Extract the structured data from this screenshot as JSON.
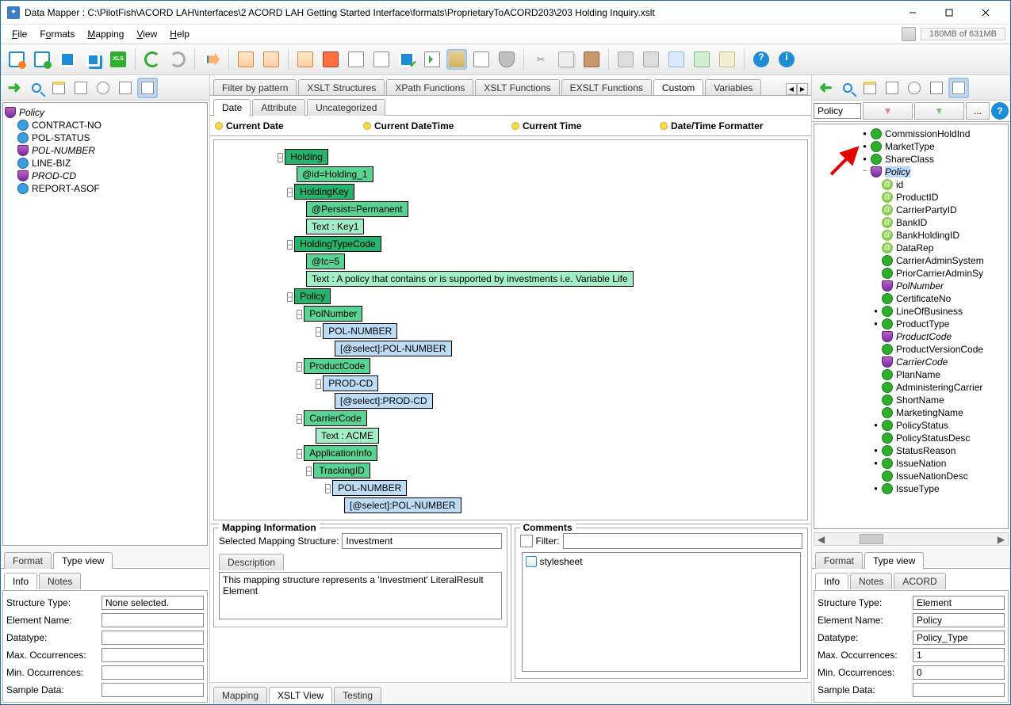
{
  "window": {
    "title": "Data Mapper : C:\\PilotFish\\ACORD LAH\\interfaces\\2 ACORD LAH Getting Started Interface\\formats\\ProprietaryToACORD203\\203 Holding Inquiry.xslt",
    "memory": "180MB of 631MB"
  },
  "menu": {
    "file": "File",
    "formats": "Formats",
    "mapping": "Mapping",
    "view": "View",
    "help": "Help"
  },
  "left_tree": {
    "root": "Policy",
    "items": [
      "CONTRACT-NO",
      "POL-STATUS",
      "POL-NUMBER",
      "LINE-BIZ",
      "PROD-CD",
      "REPORT-ASOF"
    ]
  },
  "left_ftabs": {
    "format": "Format",
    "typeview": "Type view"
  },
  "left_info_tabs": {
    "info": "Info",
    "notes": "Notes"
  },
  "left_info": {
    "structureType_l": "Structure Type:",
    "structureType": "None selected.",
    "elementName_l": "Element Name:",
    "elementName": "",
    "datatype_l": "Datatype:",
    "datatype": "",
    "maxocc_l": "Max. Occurrences:",
    "maxocc": "",
    "minocc_l": "Min. Occurrences:",
    "minocc": "",
    "sample_l": "Sample Data:",
    "sample": ""
  },
  "mid_tabs": {
    "filter": "Filter by pattern",
    "xsltstruct": "XSLT Structures",
    "xpath": "XPath Functions",
    "xsltfn": "XSLT Functions",
    "exslt": "EXSLT Functions",
    "custom": "Custom",
    "variables": "Variables"
  },
  "mid_subtabs": {
    "date": "Date",
    "attribute": "Attribute",
    "uncat": "Uncategorized"
  },
  "mid_pills": {
    "a": "Current Date",
    "b": "Current DateTime",
    "c": "Current Time",
    "d": "Date/Time Formatter"
  },
  "xslt_tree": {
    "holding": "Holding",
    "holding_id": "@id=Holding_1",
    "holdingkey": "HoldingKey",
    "persist": "@Persist=Permanent",
    "key1": "Text : Key1",
    "htc": "HoldingTypeCode",
    "tc5": "@tc=5",
    "tctext": "Text : A policy that contains or is supported by investments i.e. Variable Life",
    "policy": "Policy",
    "polnumber": "PolNumber",
    "polnumber_src": "POL-NUMBER",
    "polnumber_sel": "[@select]:POL-NUMBER",
    "productcode": "ProductCode",
    "prodcd_src": "PROD-CD",
    "prodcd_sel": "[@select]:PROD-CD",
    "carriercode": "CarrierCode",
    "acme": "Text : ACME",
    "appinfo": "ApplicationInfo",
    "trackingid": "TrackingID",
    "trackingid_src": "POL-NUMBER",
    "trackingid_sel": "[@select]:POL-NUMBER"
  },
  "mapinfo": {
    "legend": "Mapping Information",
    "selmap_l": "Selected Mapping Structure:",
    "selmap": "Investment",
    "desc_l": "Description",
    "desc": "This mapping structure represents a 'Investment' LiteralResult Element"
  },
  "comments": {
    "legend": "Comments",
    "filter_l": "Filter:",
    "filter_v": "",
    "body": "stylesheet"
  },
  "mid_bottom_tabs": {
    "mapping": "Mapping",
    "xsltview": "XSLT View",
    "testing": "Testing"
  },
  "right_search": {
    "value": "Policy",
    "more": "..."
  },
  "right_tree": {
    "items": [
      {
        "l": "CommissionHoldInd",
        "i": "g",
        "d": 4,
        "e": "•"
      },
      {
        "l": "MarketType",
        "i": "g",
        "d": 4,
        "e": "•"
      },
      {
        "l": "ShareClass",
        "i": "g",
        "d": 4,
        "e": "•"
      },
      {
        "l": "Policy",
        "i": "shield",
        "d": 4,
        "e": "−",
        "sel": true,
        "it": true
      },
      {
        "l": "id",
        "i": "at",
        "d": 5,
        "e": ""
      },
      {
        "l": "ProductID",
        "i": "at",
        "d": 5,
        "e": ""
      },
      {
        "l": "CarrierPartyID",
        "i": "at",
        "d": 5,
        "e": ""
      },
      {
        "l": "BankID",
        "i": "at",
        "d": 5,
        "e": ""
      },
      {
        "l": "BankHoldingID",
        "i": "at",
        "d": 5,
        "e": ""
      },
      {
        "l": "DataRep",
        "i": "at",
        "d": 5,
        "e": ""
      },
      {
        "l": "CarrierAdminSystem",
        "i": "g",
        "d": 5,
        "e": ""
      },
      {
        "l": "PriorCarrierAdminSy",
        "i": "g",
        "d": 5,
        "e": ""
      },
      {
        "l": "PolNumber",
        "i": "shield",
        "d": 5,
        "e": "",
        "it": true
      },
      {
        "l": "CertificateNo",
        "i": "g",
        "d": 5,
        "e": ""
      },
      {
        "l": "LineOfBusiness",
        "i": "g",
        "d": 5,
        "e": "•"
      },
      {
        "l": "ProductType",
        "i": "g",
        "d": 5,
        "e": "•"
      },
      {
        "l": "ProductCode",
        "i": "shield",
        "d": 5,
        "e": "",
        "it": true
      },
      {
        "l": "ProductVersionCode",
        "i": "g",
        "d": 5,
        "e": ""
      },
      {
        "l": "CarrierCode",
        "i": "shield",
        "d": 5,
        "e": "",
        "it": true
      },
      {
        "l": "PlanName",
        "i": "g",
        "d": 5,
        "e": ""
      },
      {
        "l": "AdministeringCarrier",
        "i": "g",
        "d": 5,
        "e": ""
      },
      {
        "l": "ShortName",
        "i": "g",
        "d": 5,
        "e": ""
      },
      {
        "l": "MarketingName",
        "i": "g",
        "d": 5,
        "e": ""
      },
      {
        "l": "PolicyStatus",
        "i": "g",
        "d": 5,
        "e": "•"
      },
      {
        "l": "PolicyStatusDesc",
        "i": "g",
        "d": 5,
        "e": ""
      },
      {
        "l": "StatusReason",
        "i": "g",
        "d": 5,
        "e": "•"
      },
      {
        "l": "IssueNation",
        "i": "g",
        "d": 5,
        "e": "•"
      },
      {
        "l": "IssueNationDesc",
        "i": "g",
        "d": 5,
        "e": ""
      },
      {
        "l": "IssueType",
        "i": "g",
        "d": 5,
        "e": "•"
      }
    ]
  },
  "right_ftabs": {
    "format": "Format",
    "typeview": "Type view"
  },
  "right_info_tabs": {
    "info": "Info",
    "notes": "Notes",
    "acord": "ACORD"
  },
  "right_info": {
    "structureType_l": "Structure Type:",
    "structureType": "Element",
    "elementName_l": "Element Name:",
    "elementName": "Policy",
    "datatype_l": "Datatype:",
    "datatype": "Policy_Type",
    "maxocc_l": "Max. Occurrences:",
    "maxocc": "1",
    "minocc_l": "Min. Occurrences:",
    "minocc": "0",
    "sample_l": "Sample Data:",
    "sample": ""
  }
}
